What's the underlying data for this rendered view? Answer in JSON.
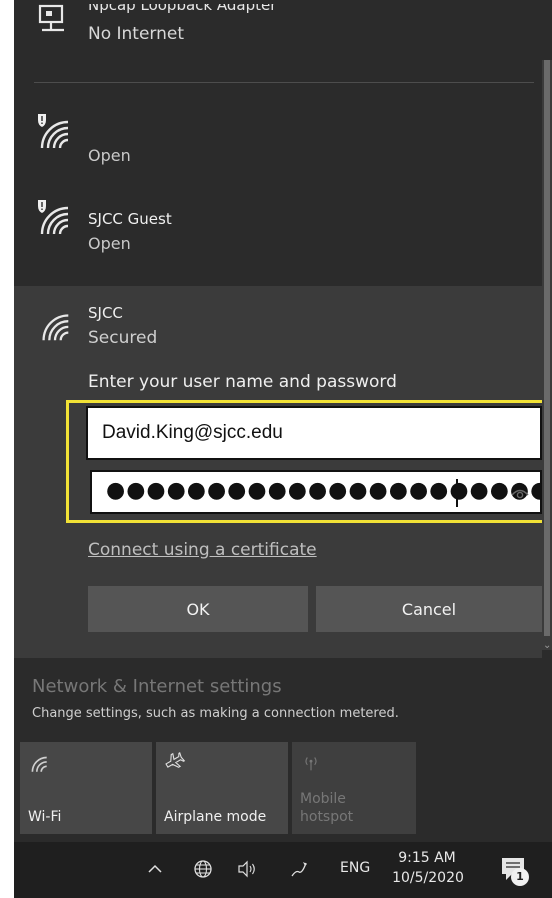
{
  "networks": {
    "top": {
      "name": "Npcap Loopback Adapter",
      "status": "No Internet",
      "icon": "ethernet-monitor-icon"
    },
    "open": {
      "name": "",
      "status": "Open",
      "icon": "wifi-secure-shield-icon"
    },
    "guest": {
      "name": "SJCC Guest",
      "status": "Open",
      "icon": "wifi-secure-shield-icon"
    },
    "sjcc": {
      "name": "SJCC",
      "status": "Secured",
      "icon": "wifi-icon",
      "prompt": "Enter your user name and password",
      "username_value": "David.King@sjcc.edu",
      "password_value": "●●●●●●●●●●●●●●●●●●●●●●●●●●●●",
      "cert_link": "Connect using a certificate",
      "ok_label": "OK",
      "cancel_label": "Cancel"
    }
  },
  "settings": {
    "title": "Network & Internet settings",
    "subtitle": "Change settings, such as making a connection metered."
  },
  "quick_actions": [
    {
      "label": "Wi-Fi",
      "icon": "wifi-icon"
    },
    {
      "label": "Airplane mode",
      "icon": "airplane-icon"
    },
    {
      "label_line1": "Mobile",
      "label_line2": "hotspot",
      "icon": "hotspot-icon"
    }
  ],
  "taskbar": {
    "language": "ENG",
    "time": "9:15 AM",
    "date": "10/5/2020",
    "notification_count": "1"
  },
  "colors": {
    "highlight": "#f2e236",
    "panel": "#2b2b2b",
    "selected": "#3b3b3b"
  }
}
